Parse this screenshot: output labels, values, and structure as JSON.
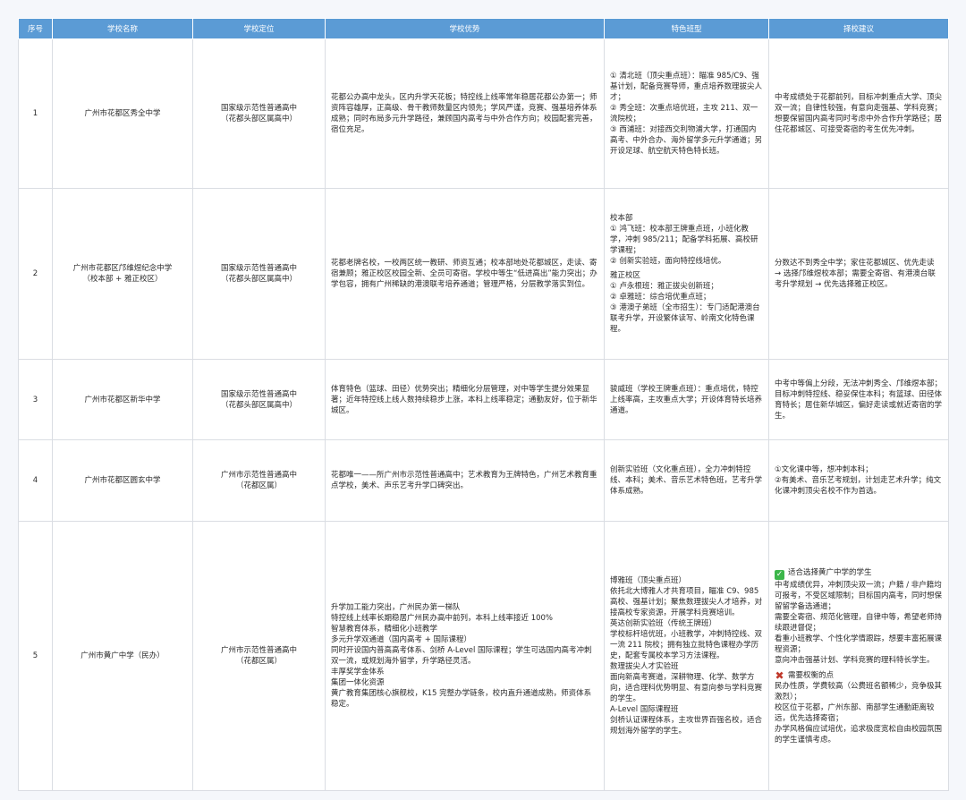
{
  "header": [
    "序号",
    "学校名称",
    "学校定位",
    "学校优势",
    "特色班型",
    "择校建议"
  ],
  "rows": [
    {
      "no": "1",
      "name": [
        "广州市花都区秀全中学"
      ],
      "position": [
        "国家级示范性普通高中",
        "（花都头部区属高中）"
      ],
      "advantage": [
        "花都公办高中龙头，区内升学天花板；特控线上线率常年稳居花都公办第一；师资阵容雄厚，正高级、骨干教师数量区内领先；学风严谨，竞赛、强基培养体系成熟；同时布局多元升学路径，兼顾国内高考与中外合作方向；校园配套完善，宿位充足。"
      ],
      "classes": [
        "① 清北班（顶尖重点班）：瞄准 985/C9、强基计划，配备竞赛导师，重点培养数理拔尖人才；",
        "② 秀全班：次重点培优班，主攻 211、双一流院校；",
        "③ 西浦班：对接西交利物浦大学，打通国内高考、中外合办、海外留学多元升学通道；另开设足球、航空航天特色特长班。"
      ],
      "advice": [
        "中考成绩处于花都前列，目标冲刺重点大学、顶尖双一流；自律性较强，有意向走强基、学科竞赛；想要保留国内高考同时考虑中外合作升学路径；居住花都城区、可接受寄宿的考生优先冲刺。"
      ]
    },
    {
      "no": "2",
      "name": [
        "广州市花都区邝维煜纪念中学",
        "（校本部 + 雅正校区）"
      ],
      "position": [
        "国家级示范性普通高中",
        "（花都头部区属高中）"
      ],
      "advantage": [
        "花都老牌名校，一校两区统一教研、师资互通；校本部地处花都城区，走读、寄宿兼顾；雅正校区校园全新、全员可寄宿。学校中等生“低进高出”能力突出；办学包容，拥有广州稀缺的港澳联考培养通道；管理严格，分层教学落实到位。"
      ],
      "classes": [
        "校本部",
        "① 鸿飞班：校本部王牌重点班，小班化教学，冲刺 985/211；配备学科拓展、高校研学课程；",
        "② 创新实验班，面向特控线培优。",
        "雅正校区",
        "① 卢永根班：雅正拔尖创新班；",
        "② 卓雅班：综合培优重点班；",
        "③ 港澳子弟班（全市招生）：专门适配港澳台联考升学，开设繁体读写、岭南文化特色课程。"
      ],
      "advice": [
        "分数达不到秀全中学；家住花都城区、优先走读 → 选择邝维煜校本部；需要全寄宿、有港澳台联考升学规划 → 优先选择雅正校区。"
      ]
    },
    {
      "no": "3",
      "name": [
        "广州市花都区新华中学"
      ],
      "position": [
        "国家级示范性普通高中",
        "（花都头部区属高中）"
      ],
      "advantage": [
        "体育特色（篮球、田径）优势突出；精细化分层管理，对中等学生提分效果显著；近年特控线上线人数持续稳步上涨，本科上线率稳定；通勤友好，位于新华城区。"
      ],
      "classes": [
        "骏威班（学校王牌重点班）：重点培优，特控上线率高，主攻重点大学；开设体育特长培养通道。"
      ],
      "advice": [
        "中考中等偏上分段，无法冲刺秀全、邝维煜本部；目标冲刺特控线、稳妥保住本科；有篮球、田径体育特长；居住新华城区，偏好走读或就近寄宿的学生。"
      ]
    },
    {
      "no": "4",
      "name": [
        "广州市花都区圆玄中学"
      ],
      "position": [
        "广州市示范性普通高中",
        "（花都区属）"
      ],
      "advantage": [
        "花都唯一——所广州市示范性普通高中；艺术教育为王牌特色，广州艺术教育重点学校，美术、声乐艺考升学口碑突出。"
      ],
      "classes": [
        "创新实验班（文化重点班），全力冲刺特控线、本科；美术、音乐艺术特色班，艺考升学体系成熟。"
      ],
      "advice": [
        "①文化课中等，想冲刺本科；",
        "②有美术、音乐艺考规划，计划走艺术升学；纯文化课冲刺顶尖名校不作为首选。"
      ]
    },
    {
      "no": "5",
      "name": [
        "广州市黄广中学（民办）"
      ],
      "position": [
        "广州市示范性普通高中",
        "（花都区属）"
      ],
      "advantage": [
        "升学加工能力突出，广州民办第一梯队",
        "特控线上线率长期稳居广州民办高中前列，本科上线率接近 100%",
        "智慧教育体系，精细化小班教学",
        "多元升学双通道（国内高考 + 国际课程）",
        "同时开设国内普高高考体系、剑桥 A-Level 国际课程；学生可选国内高考冲刺双一流，或规划海外留学，升学路径灵活。",
        "丰厚奖学金体系",
        "集团一体化资源",
        "黄广教育集团核心旗舰校，K15 完整办学链条，校内直升通道成熟，师资体系稳定。"
      ],
      "classes": [
        "博雅班（顶尖重点班）",
        "依托北大博雅人才共育项目，瞄准 C9、985 高校、强基计划；聚焦数理拔尖人才培养，对接高校专家资源，开展学科竞赛培训。",
        "英达创新实验班（传统王牌班）",
        "学校标杆培优班，小班教学，冲刺特控线、双一流 211 院校；拥有独立批特色课程办学历史，配套专属校本学习方法课程。",
        "数理拔尖人才实验班",
        "面向新高考赛道，深耕物理、化学、数学方向，适合理科优势明显、有意向参与学科竞赛的学生。",
        "A-Level 国际课程班",
        "剑桥认证课程体系，主攻世界百强名校，适合规划海外留学的学生。"
      ],
      "advice_good_title": "适合选择黄广中学的学生",
      "advice_good": [
        "中考成绩优异，冲刺顶尖双一流；户籍 / 非户籍均可报考，不受区域限制；目标国内高考，同时想保留留学备选通道；",
        "需要全寄宿、规范化管理，自律中等，希望老师持续跟进督促；",
        "看重小班教学、个性化学情跟踪，想要丰富拓展课程资源；",
        "意向冲击强基计划、学科竞赛的理科特长学生。"
      ],
      "advice_bad_title": "需要权衡的点",
      "advice_bad": [
        "民办性质，学费较高（公费班名额稀少，竞争极其激烈）；",
        "校区位于花都，广州东部、南部学生通勤距离较远，优先选择寄宿；",
        "办学风格偏应试培优，追求极度宽松自由校园氛围的学生谨慎考虑。"
      ]
    }
  ]
}
